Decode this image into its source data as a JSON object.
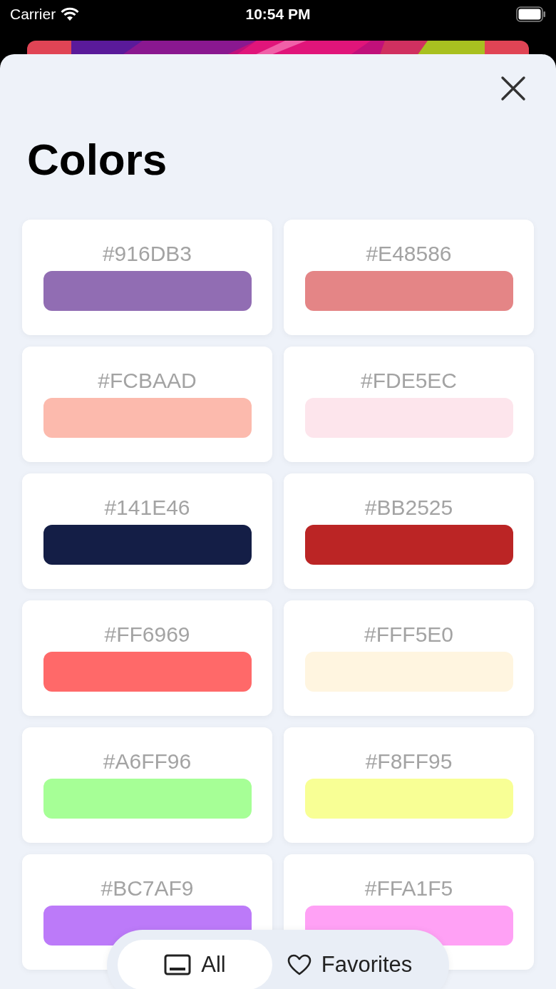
{
  "status_bar": {
    "carrier": "Carrier",
    "time": "10:54 PM"
  },
  "sheet": {
    "title": "Colors"
  },
  "colors": [
    {
      "hex": "#916DB3",
      "color": "#916db3"
    },
    {
      "hex": "#E48586",
      "color": "#e48586"
    },
    {
      "hex": "#FCBAAD",
      "color": "#fcbaad"
    },
    {
      "hex": "#FDE5EC",
      "color": "#fde5ec"
    },
    {
      "hex": "#141E46",
      "color": "#141e46"
    },
    {
      "hex": "#BB2525",
      "color": "#bb2525"
    },
    {
      "hex": "#FF6969",
      "color": "#ff6969"
    },
    {
      "hex": "#FFF5E0",
      "color": "#fff5e0"
    },
    {
      "hex": "#A6FF96",
      "color": "#a6ff96"
    },
    {
      "hex": "#F8FF95",
      "color": "#f8ff95"
    },
    {
      "hex": "#BC7AF9",
      "color": "#bc7af9"
    },
    {
      "hex": "#FFA1F5",
      "color": "#ffa1f5"
    }
  ],
  "tabs": [
    {
      "label": "All",
      "kind": "all",
      "selected": true
    },
    {
      "label": "Favorites",
      "kind": "favorites",
      "selected": false
    }
  ]
}
